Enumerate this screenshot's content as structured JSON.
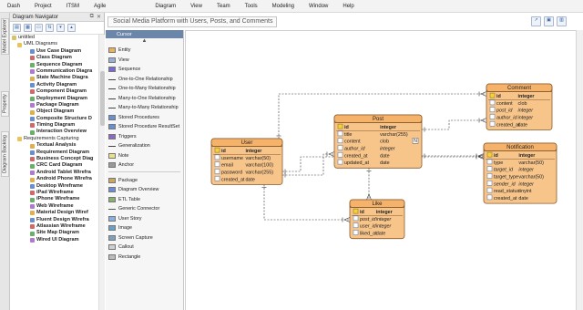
{
  "menu": {
    "items": [
      "Dash",
      "Project",
      "ITSM",
      "Agile",
      "Diagram",
      "View",
      "Team",
      "Tools",
      "Modeling",
      "Window",
      "Help"
    ]
  },
  "side_tabs": [
    "Model Explorer",
    "Property",
    "Diagram Backlog"
  ],
  "navigator": {
    "title": "Diagram Navigator",
    "root": "untitled",
    "items": [
      {
        "label": "UML Diagrams",
        "kind": "cat"
      },
      {
        "label": "Use Case Diagram",
        "kind": "item"
      },
      {
        "label": "Class Diagram",
        "kind": "item"
      },
      {
        "label": "Sequence Diagram",
        "kind": "item"
      },
      {
        "label": "Communication Diagra",
        "kind": "item"
      },
      {
        "label": "State Machine Diagra",
        "kind": "item"
      },
      {
        "label": "Activity Diagram",
        "kind": "item"
      },
      {
        "label": "Component Diagram",
        "kind": "item"
      },
      {
        "label": "Deployment Diagram",
        "kind": "item"
      },
      {
        "label": "Package Diagram",
        "kind": "item"
      },
      {
        "label": "Object Diagram",
        "kind": "item"
      },
      {
        "label": "Composite Structure D",
        "kind": "item"
      },
      {
        "label": "Timing Diagram",
        "kind": "item"
      },
      {
        "label": "Interaction Overview",
        "kind": "item"
      },
      {
        "label": "Requirements Capturing",
        "kind": "cat"
      },
      {
        "label": "Textual Analysis",
        "kind": "item"
      },
      {
        "label": "Requirement Diagram",
        "kind": "item"
      },
      {
        "label": "Business Concept Diag",
        "kind": "item"
      },
      {
        "label": "CRC Card Diagram",
        "kind": "item"
      },
      {
        "label": "Android Tablet Wirefra",
        "kind": "item"
      },
      {
        "label": "Android Phone Wirefra",
        "kind": "item"
      },
      {
        "label": "Desktop Wireframe",
        "kind": "item"
      },
      {
        "label": "iPad Wireframe",
        "kind": "item"
      },
      {
        "label": "iPhone Wireframe",
        "kind": "item"
      },
      {
        "label": "Web Wireframe",
        "kind": "item"
      },
      {
        "label": "Material Design Wiref",
        "kind": "item"
      },
      {
        "label": "Fluent Design Wirefra",
        "kind": "item"
      },
      {
        "label": "Atlassian Wireframe",
        "kind": "item"
      },
      {
        "label": "Site Map Diagram",
        "kind": "item"
      },
      {
        "label": "Wired UI Diagram",
        "kind": "item"
      }
    ]
  },
  "document": {
    "title": "Social Media Platform with Users, Posts, and Comments"
  },
  "palette": {
    "cursor": "Cursor",
    "items": [
      "Entity",
      "View",
      "Sequence",
      "One-to-One Relationship",
      "One-to-Many Relationship",
      "Many-to-One Relationship",
      "Many-to-Many Relationship",
      "Stored Procedures",
      "Stored Procedure ResultSet",
      "Triggers",
      "Generalization",
      "Note",
      "Anchor",
      "",
      "Package",
      "Diagram Overview",
      "ETL Table",
      "Generic Connector",
      "User Story",
      "Image",
      "Screen Capture",
      "Callout",
      "Rectangle"
    ]
  },
  "entities": [
    {
      "name": "User",
      "rows": [
        [
          "id",
          "integer"
        ],
        [
          "username",
          "varchar(50)"
        ],
        [
          "email",
          "varchar(100)"
        ],
        [
          "password",
          "varchar(255)"
        ],
        [
          "created_at",
          "date"
        ]
      ],
      "pk": [
        0
      ],
      "fk": [],
      "n": []
    },
    {
      "name": "Post",
      "rows": [
        [
          "id",
          "integer"
        ],
        [
          "title",
          "varchar(255)"
        ],
        [
          "content",
          "clob"
        ],
        [
          "author_id",
          "integer"
        ],
        [
          "created_at",
          "date"
        ],
        [
          "updated_at",
          "date"
        ]
      ],
      "pk": [
        0
      ],
      "fk": [
        3
      ],
      "n": [
        2
      ]
    },
    {
      "name": "Comment",
      "rows": [
        [
          "id",
          "integer"
        ],
        [
          "content",
          "clob"
        ],
        [
          "post_id",
          "integer"
        ],
        [
          "author_id",
          "integer"
        ],
        [
          "created_at",
          "date"
        ]
      ],
      "pk": [
        0
      ],
      "fk": [
        2,
        3
      ],
      "n": []
    },
    {
      "name": "Like",
      "rows": [
        [
          "id",
          "integer"
        ],
        [
          "post_id",
          "integer"
        ],
        [
          "user_id",
          "integer"
        ],
        [
          "liked_at",
          "date"
        ]
      ],
      "pk": [
        0
      ],
      "fk": [
        1,
        2
      ],
      "n": []
    },
    {
      "name": "Notification",
      "rows": [
        [
          "id",
          "integer"
        ],
        [
          "type",
          "varchar(50)"
        ],
        [
          "target_id",
          "integer"
        ],
        [
          "target_type",
          "varchar(50)"
        ],
        [
          "sender_id",
          "integer"
        ],
        [
          "read_status",
          "tinyint"
        ],
        [
          "created_at",
          "date"
        ]
      ],
      "pk": [
        0
      ],
      "fk": [
        2,
        4
      ],
      "n": []
    }
  ],
  "colors": {
    "entity_fill": "#f7c48a",
    "entity_border": "#8a5a2a",
    "header_fill": "#f5b26b",
    "palette_head": "#6b86a8"
  }
}
